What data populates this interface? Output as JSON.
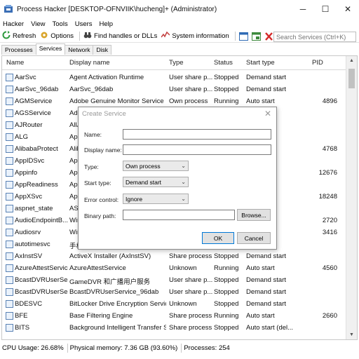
{
  "window": {
    "title": "Process Hacker [DESKTOP-OFNVIIK\\hucheng]+ (Administrator)",
    "minimize": "─",
    "maximize": "☐",
    "close": "✕"
  },
  "menu": [
    "Hacker",
    "View",
    "Tools",
    "Users",
    "Help"
  ],
  "toolbar": {
    "refresh": "Refresh",
    "options": "Options",
    "find_handles": "Find handles or DLLs",
    "system_info": "System information",
    "search_placeholder": "Search Services (Ctrl+K)"
  },
  "tabs": [
    "Processes",
    "Services",
    "Network",
    "Disk"
  ],
  "columns": {
    "name": "Name",
    "display_name": "Display name",
    "type": "Type",
    "status": "Status",
    "start_type": "Start type",
    "pid": "PID"
  },
  "rows": [
    {
      "name": "AarSvc",
      "display": "Agent Activation Runtime",
      "type": "User share p...",
      "status": "Stopped",
      "start": "Demand start",
      "pid": ""
    },
    {
      "name": "AarSvc_96dab",
      "display": "AarSvc_96dab",
      "type": "User share p...",
      "status": "Stopped",
      "start": "Demand start",
      "pid": ""
    },
    {
      "name": "AGMService",
      "display": "Adobe Genuine Monitor Service",
      "type": "Own process",
      "status": "Running",
      "start": "Auto start",
      "pid": "4896"
    },
    {
      "name": "AGSService",
      "display": "Ado",
      "type": "",
      "status": "",
      "start": "rt",
      "pid": ""
    },
    {
      "name": "AJRouter",
      "display": "AllJ",
      "type": "",
      "status": "",
      "start": "rt (trig...",
      "pid": ""
    },
    {
      "name": "ALG",
      "display": "App",
      "type": "",
      "status": "",
      "start": "rt",
      "pid": ""
    },
    {
      "name": "AlibabaProtect",
      "display": "Alib",
      "type": "",
      "status": "",
      "start": "rt",
      "pid": "4768"
    },
    {
      "name": "AppIDSvc",
      "display": "App",
      "type": "",
      "status": "",
      "start": "rt (trig...",
      "pid": ""
    },
    {
      "name": "Appinfo",
      "display": "App",
      "type": "",
      "status": "",
      "start": "rt (trig...",
      "pid": "12676"
    },
    {
      "name": "AppReadiness",
      "display": "App",
      "type": "",
      "status": "",
      "start": "rt",
      "pid": ""
    },
    {
      "name": "AppXSvc",
      "display": "App",
      "type": "",
      "status": "",
      "start": "rt (trig...",
      "pid": "18248"
    },
    {
      "name": "aspnet_state",
      "display": "ASP.",
      "type": "",
      "status": "",
      "start": "rt",
      "pid": ""
    },
    {
      "name": "AudioEndpointB...",
      "display": "Win",
      "type": "",
      "status": "",
      "start": "",
      "pid": "2720"
    },
    {
      "name": "Audiosrv",
      "display": "Win",
      "type": "",
      "status": "",
      "start": "",
      "pid": "3416"
    },
    {
      "name": "autotimesvc",
      "display": "手机",
      "type": "",
      "status": "",
      "start": "rt (trig...",
      "pid": ""
    },
    {
      "name": "AxInstSV",
      "display": "ActiveX Installer (AxInstSV)",
      "type": "Share process",
      "status": "Stopped",
      "start": "Demand start",
      "pid": ""
    },
    {
      "name": "AzureAttestService",
      "display": "AzureAttestService",
      "type": "Unknown",
      "status": "Running",
      "start": "Auto start",
      "pid": "4560"
    },
    {
      "name": "BcastDVRUserSe...",
      "display": "GameDVR 和广播用户服务",
      "type": "User share p...",
      "status": "Stopped",
      "start": "Demand start",
      "pid": ""
    },
    {
      "name": "BcastDVRUserSe...",
      "display": "BcastDVRUserService_96dab",
      "type": "User share p...",
      "status": "Stopped",
      "start": "Demand start",
      "pid": ""
    },
    {
      "name": "BDESVC",
      "display": "BitLocker Drive Encryption Service",
      "type": "Unknown",
      "status": "Stopped",
      "start": "Demand start",
      "pid": ""
    },
    {
      "name": "BFE",
      "display": "Base Filtering Engine",
      "type": "Share process",
      "status": "Running",
      "start": "Auto start",
      "pid": "2660"
    },
    {
      "name": "BITS",
      "display": "Background Intelligent Transfer S...",
      "type": "Share process",
      "status": "Stopped",
      "start": "Auto start (del...",
      "pid": ""
    }
  ],
  "status_bar": {
    "cpu": "CPU Usage: 26.68%",
    "memory": "Physical memory: 7.36 GB (93.60%)",
    "processes": "Processes: 254"
  },
  "dialog": {
    "title": "Create Service",
    "close": "✕",
    "name_label": "Name:",
    "display_name_label": "Display name:",
    "type_label": "Type:",
    "type_value": "Own process",
    "start_type_label": "Start type:",
    "start_type_value": "Demand start",
    "error_control_label": "Error control:",
    "error_control_value": "Ignore",
    "binary_path_label": "Binary path:",
    "browse": "Browse...",
    "ok": "OK",
    "cancel": "Cancel"
  }
}
